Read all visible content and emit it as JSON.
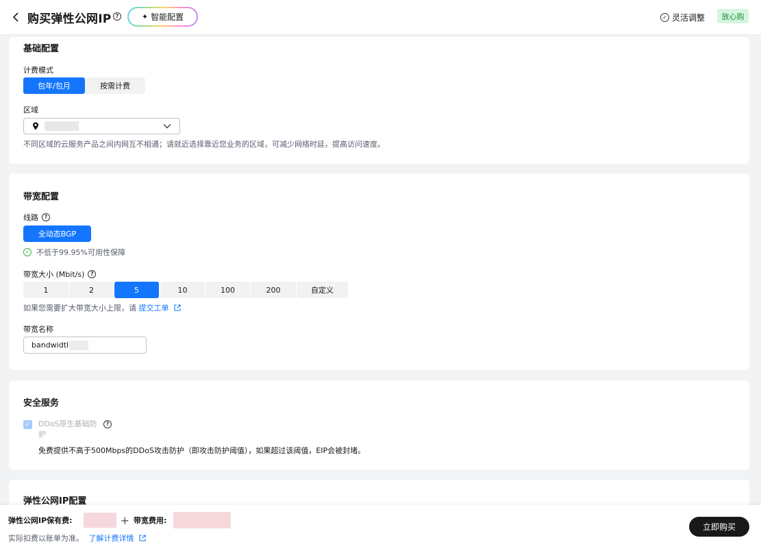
{
  "header": {
    "title": "购买弹性公网IP",
    "smart_config": "智能配置",
    "flex_adjust": "灵活调整",
    "safe_badge": "放心购"
  },
  "basic": {
    "title": "基础配置",
    "billing_label": "计费模式",
    "billing_options": [
      "包年/包月",
      "按需计费"
    ],
    "billing_selected": "包年/包月",
    "region_label": "区域",
    "region_hint": "不同区域的云服务产品之间内网互不相通；请就近选择靠近您业务的区域，可减少网络时延，提高访问速度。"
  },
  "bandwidth": {
    "title": "带宽配置",
    "line_label": "线路",
    "line_value": "全动态BGP",
    "guarantee": "不低于99.95%可用性保障",
    "size_label": "带宽大小 (Mbit/s)",
    "size_options": [
      "1",
      "2",
      "5",
      "10",
      "100",
      "200",
      "自定义"
    ],
    "size_selected": "5",
    "expand_hint": "如果您需要扩大带宽大小上限，请",
    "expand_link": "提交工单",
    "name_label": "带宽名称",
    "name_value": "bandwidtl"
  },
  "security": {
    "title": "安全服务",
    "ddos_label": "DDoS原生基础防护",
    "ddos_desc": "免费提供不高于500Mbps的DDoS攻击防护（即攻击防护阈值），如果超过该阈值，EIP会被封堵。"
  },
  "eip": {
    "title": "弹性公网IP配置"
  },
  "footer": {
    "eip_fee_label": "弹性公网IP保有费:",
    "bandwidth_fee_label": "带宽费用:",
    "note": "实际扣费以账单为准。",
    "detail_link": "了解计费详情",
    "buy_button": "立即购买"
  },
  "colors": {
    "primary": "#1476ff",
    "success": "#3ab03e",
    "badge_bg": "#d6f5de",
    "buy_button_bg": "#191919"
  }
}
